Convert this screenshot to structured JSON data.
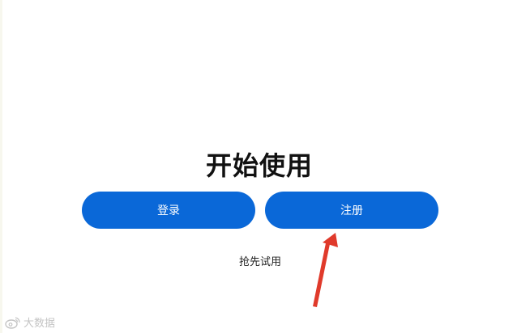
{
  "colors": {
    "accent": "#0a68d8",
    "background": "#ffffff",
    "arrow": "#e03a2b",
    "watermark": "#c4c4c4"
  },
  "main": {
    "title": "开始使用",
    "login_label": "登录",
    "register_label": "注册",
    "trial_link": "抢先试用"
  },
  "annotation": {
    "arrow_icon": "red-arrow-icon"
  },
  "watermark": {
    "icon": "weibo-logo-icon",
    "text": "大数据"
  }
}
